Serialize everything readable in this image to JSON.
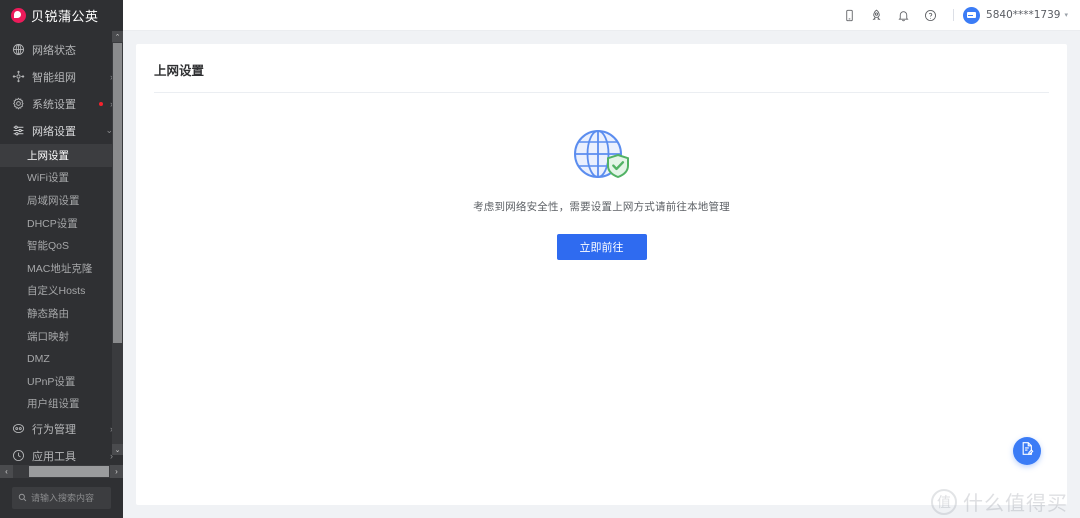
{
  "brand": {
    "name": "贝锐蒲公英"
  },
  "sidebar": {
    "nav": [
      {
        "label": "网络状态",
        "icon": "globe-grid-icon",
        "chevron": "",
        "dot": false
      },
      {
        "label": "智能组网",
        "icon": "network-node-icon",
        "chevron": "›",
        "dot": false
      },
      {
        "label": "系统设置",
        "icon": "gear-icon",
        "chevron": "›",
        "dot": true
      },
      {
        "label": "网络设置",
        "icon": "sliders-icon",
        "chevron": "⌄",
        "dot": false
      }
    ],
    "submenu": [
      {
        "label": "上网设置",
        "active": true
      },
      {
        "label": "WiFi设置",
        "active": false
      },
      {
        "label": "局域网设置",
        "active": false
      },
      {
        "label": "DHCP设置",
        "active": false
      },
      {
        "label": "智能QoS",
        "active": false
      },
      {
        "label": "MAC地址克隆",
        "active": false
      },
      {
        "label": "自定义Hosts",
        "active": false
      },
      {
        "label": "静态路由",
        "active": false
      },
      {
        "label": "端口映射",
        "active": false
      },
      {
        "label": "DMZ",
        "active": false
      },
      {
        "label": "UPnP设置",
        "active": false
      },
      {
        "label": "用户组设置",
        "active": false
      }
    ],
    "nav_bottom": [
      {
        "label": "行为管理",
        "icon": "behavior-icon",
        "chevron": "›",
        "dot": false
      },
      {
        "label": "应用工具",
        "icon": "tools-icon",
        "chevron": "›",
        "dot": false
      }
    ],
    "search": {
      "placeholder": "请输入搜索内容",
      "value": "",
      "icon": "search-icon"
    },
    "scroll": {
      "up": "⌃",
      "down": "⌄",
      "left": "‹",
      "right": "›"
    }
  },
  "topbar": {
    "icons": [
      {
        "name": "mobile-icon"
      },
      {
        "name": "rocket-icon"
      },
      {
        "name": "bell-icon"
      },
      {
        "name": "help-icon"
      }
    ],
    "user": {
      "name": "5840****1739",
      "caret": "▾",
      "avatar_icon": "id-card-icon"
    }
  },
  "main": {
    "title": "上网设置",
    "empty": {
      "illustration": "globe-shield-check-icon",
      "message": "考虑到网络安全性，需要设置上网方式请前往本地管理",
      "button_label": "立即前往"
    },
    "fab": {
      "icon": "document-edit-icon"
    }
  },
  "watermark": {
    "mark": "值",
    "text": "什么值得买"
  },
  "colors": {
    "sidebar_bg": "#2f3033",
    "sidebar_active": "#3c3d40",
    "brand_pink": "#ec1b5a",
    "primary_blue": "#2f6bf0",
    "avatar_blue": "#3b7cf6",
    "globe_blue": "#5b8def",
    "shield_green": "#52b265",
    "content_bg": "#f0f2f5",
    "red_dot": "#f5222d"
  }
}
